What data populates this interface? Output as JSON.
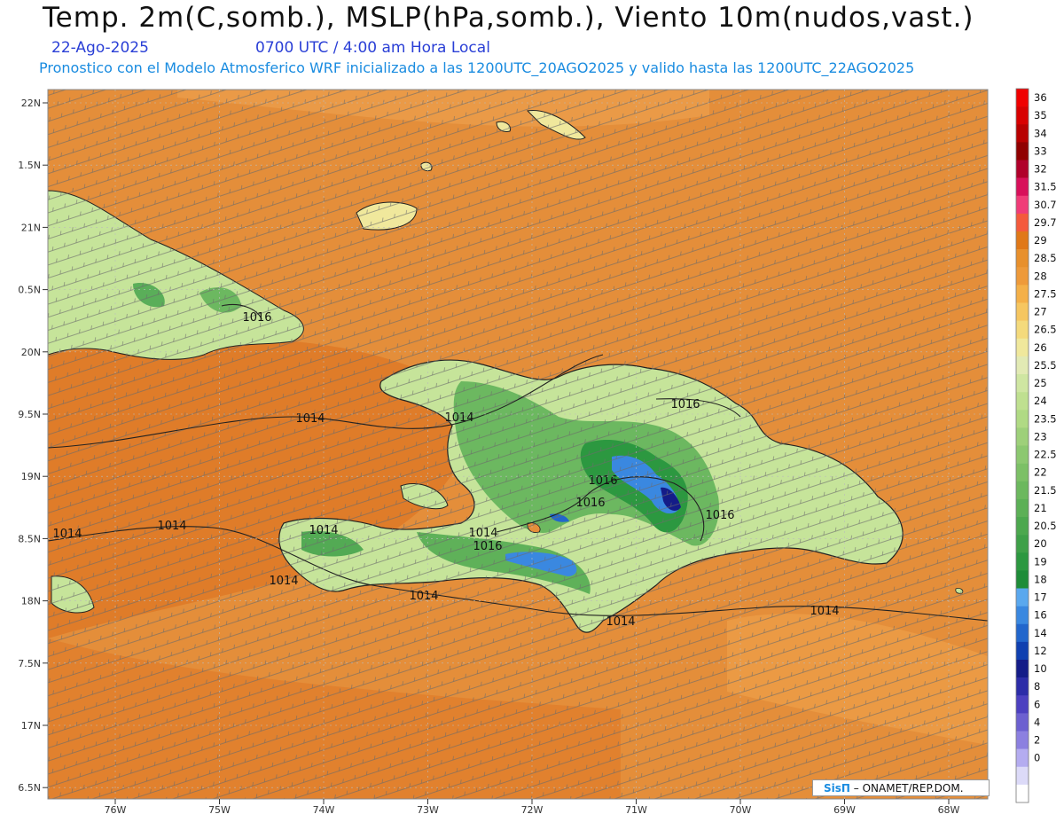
{
  "header": {
    "title": "Temp. 2m(C,somb.), MSLP(hPa,somb.), Viento 10m(nudos,vast.)",
    "date": "22-Ago-2025",
    "time": "0700 UTC / 4:00 am Hora Local",
    "description": "Pronostico con el Modelo Atmosferico WRF inicializado a las 1200UTC_20AGO2025 y valido hasta las  1200UTC_22AGO2025"
  },
  "axes": {
    "lat_labels": [
      "22N",
      "1.5N",
      "21N",
      "0.5N",
      "20N",
      "9.5N",
      "19N",
      "8.5N",
      "18N",
      "7.5N",
      "17N",
      "6.5N"
    ],
    "lon_labels": [
      "76W",
      "75W",
      "74W",
      "73W",
      "72W",
      "71W",
      "70W",
      "69W",
      "68W"
    ]
  },
  "isobars": {
    "labels": [
      "1016",
      "1016",
      "1014",
      "1014",
      "1016",
      "1016",
      "1016",
      "1014",
      "1014",
      "1014",
      "1014",
      "1014",
      "1016",
      "1014",
      "1014",
      "1014"
    ]
  },
  "colorbar": {
    "levels": [
      "36",
      "35",
      "34",
      "33",
      "32",
      "31.5",
      "30.7",
      "29.7",
      "29",
      "28.5",
      "28",
      "27.5",
      "27",
      "26.5",
      "26",
      "25.5",
      "25",
      "24",
      "23.5",
      "23",
      "22.5",
      "22",
      "21.5",
      "21",
      "20.5",
      "20",
      "19",
      "18",
      "17",
      "16",
      "14",
      "12",
      "10",
      "8",
      "6",
      "4",
      "2",
      "0"
    ],
    "colors": [
      "#f00000",
      "#d80000",
      "#b80000",
      "#900000",
      "#b0002a",
      "#d8105a",
      "#f03c78",
      "#f45a3c",
      "#e07818",
      "#e8902c",
      "#ee9a3a",
      "#f4b048",
      "#f6c660",
      "#f4da7c",
      "#f0e89c",
      "#e2eab4",
      "#cfe6a2",
      "#bfe090",
      "#b0da84",
      "#9ed07a",
      "#8cc870",
      "#7cc066",
      "#6cb85e",
      "#5cb056",
      "#4ca84e",
      "#3ea048",
      "#2c9840",
      "#1e8c38",
      "#5aa8ee",
      "#3a88e0",
      "#2266cc",
      "#1040b0",
      "#141c88",
      "#2c2ca8",
      "#4c40c0",
      "#6c60d0",
      "#8c80e0",
      "#b4acf0",
      "#dcdaf8",
      "#ffffff"
    ]
  },
  "credit": {
    "logo": "SisΠ",
    "text": "ONAMET/REP.DOM."
  }
}
